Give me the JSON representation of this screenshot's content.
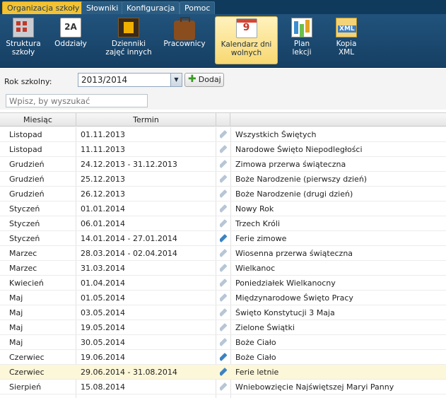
{
  "menu": {
    "tabs": [
      "Organizacja szkoły",
      "Słowniki",
      "Konfiguracja",
      "Pomoc"
    ],
    "active": 0
  },
  "ribbon": {
    "buttons": [
      {
        "label1": "Struktura",
        "label2": "szkoły",
        "icon": "building-icon"
      },
      {
        "label1": "Oddziały",
        "label2": "",
        "icon": "class-2a-icon",
        "icon_text": "2A"
      },
      {
        "label1": "Dzienniki",
        "label2": "zajęć innych",
        "icon": "film-journal-icon"
      },
      {
        "label1": "Pracownicy",
        "label2": "",
        "icon": "briefcase-icon"
      },
      {
        "label1": "Kalendarz dni",
        "label2": "wolnych",
        "icon": "calendar-icon",
        "icon_text": "9"
      },
      {
        "label1": "Plan",
        "label2": "lekcji",
        "icon": "timetable-icon"
      },
      {
        "label1": "Kopia",
        "label2": "XML",
        "icon": "xml-file-icon"
      }
    ],
    "active": 4
  },
  "toolbar": {
    "year_label": "Rok szkolny:",
    "year_value": "2013/2014",
    "add_label": "Dodaj",
    "search_placeholder": "Wpisz, by wyszukać"
  },
  "grid": {
    "columns": [
      "Miesiąc",
      "Termin",
      "",
      ""
    ],
    "rows": [
      {
        "month": "Listopad",
        "term": "01.11.2013",
        "name": "Wszystkich Świętych",
        "edit_active": false
      },
      {
        "month": "Listopad",
        "term": "11.11.2013",
        "name": "Narodowe Święto Niepodległości",
        "edit_active": false
      },
      {
        "month": "Grudzień",
        "term": "24.12.2013 - 31.12.2013",
        "name": "Zimowa przerwa świąteczna",
        "edit_active": false
      },
      {
        "month": "Grudzień",
        "term": "25.12.2013",
        "name": "Boże Narodzenie (pierwszy dzień)",
        "edit_active": false
      },
      {
        "month": "Grudzień",
        "term": "26.12.2013",
        "name": "Boże Narodzenie (drugi dzień)",
        "edit_active": false
      },
      {
        "month": "Styczeń",
        "term": "01.01.2014",
        "name": "Nowy Rok",
        "edit_active": false
      },
      {
        "month": "Styczeń",
        "term": "06.01.2014",
        "name": "Trzech Króli",
        "edit_active": false
      },
      {
        "month": "Styczeń",
        "term": "14.01.2014 - 27.01.2014",
        "name": "Ferie zimowe",
        "edit_active": true
      },
      {
        "month": "Marzec",
        "term": "28.03.2014 - 02.04.2014",
        "name": "Wiosenna przerwa świąteczna",
        "edit_active": false
      },
      {
        "month": "Marzec",
        "term": "31.03.2014",
        "name": "Wielkanoc",
        "edit_active": false
      },
      {
        "month": "Kwiecień",
        "term": "01.04.2014",
        "name": "Poniedziałek Wielkanocny",
        "edit_active": false
      },
      {
        "month": "Maj",
        "term": "01.05.2014",
        "name": "Międzynarodowe Święto Pracy",
        "edit_active": false
      },
      {
        "month": "Maj",
        "term": "03.05.2014",
        "name": "Święto Konstytucji 3 Maja",
        "edit_active": false
      },
      {
        "month": "Maj",
        "term": "19.05.2014",
        "name": "Zielone Świątki",
        "edit_active": false
      },
      {
        "month": "Maj",
        "term": "30.05.2014",
        "name": "Boże Ciało",
        "edit_active": false
      },
      {
        "month": "Czerwiec",
        "term": "19.06.2014",
        "name": "Boże Ciało",
        "edit_active": true
      },
      {
        "month": "Czerwiec",
        "term": "29.06.2014 - 31.08.2014",
        "name": "Ferie letnie",
        "edit_active": true,
        "selected": true
      },
      {
        "month": "Sierpień",
        "term": "15.08.2014",
        "name": "Wniebowzięcie Najświętszej Maryi Panny",
        "edit_active": false
      }
    ]
  },
  "colors": {
    "menu_active": "#f3c233",
    "ribbon_bg": "#1a4a72",
    "selected_row": "#fdf7d9",
    "edit_icon_active": "#3c82c3"
  }
}
